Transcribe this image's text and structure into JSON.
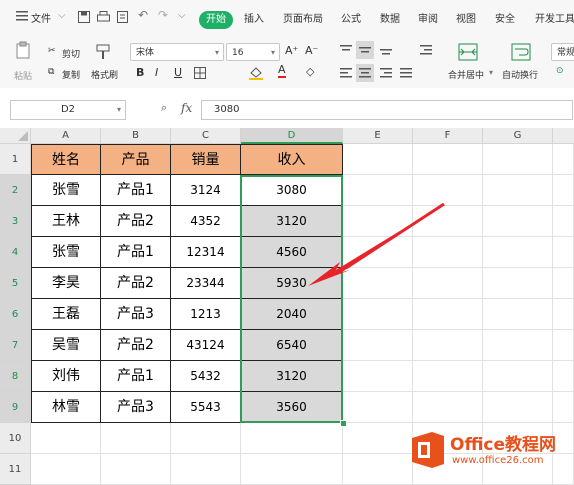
{
  "menubar": {
    "file": "文件",
    "tabs": [
      "开始",
      "插入",
      "页面布局",
      "公式",
      "数据",
      "审阅",
      "视图",
      "安全",
      "开发工具"
    ]
  },
  "ribbon": {
    "paste": "粘贴",
    "cut": "剪切",
    "copy": "复制",
    "format_painter": "格式刷",
    "font_name": "宋体",
    "font_size": "16",
    "bold": "B",
    "italic": "I",
    "underline": "U",
    "merge_center": "合并居中",
    "auto_wrap": "自动换行",
    "number_format": "常规"
  },
  "formula_bar": {
    "name_box": "D2",
    "fx": "fx",
    "value": "3080"
  },
  "sheet": {
    "columns": [
      "A",
      "B",
      "C",
      "D",
      "E",
      "F",
      "G"
    ],
    "rows": [
      "1",
      "2",
      "3",
      "4",
      "5",
      "6",
      "7",
      "8",
      "9",
      "10",
      "11"
    ],
    "headers": [
      "姓名",
      "产品",
      "销量",
      "收入"
    ],
    "data": [
      [
        "张雪",
        "产品1",
        "3124",
        "3080"
      ],
      [
        "王林",
        "产品2",
        "4352",
        "3120"
      ],
      [
        "张雪",
        "产品1",
        "12314",
        "4560"
      ],
      [
        "李昊",
        "产品2",
        "23344",
        "5930"
      ],
      [
        "王磊",
        "产品3",
        "1213",
        "2040"
      ],
      [
        "吴雪",
        "产品2",
        "43124",
        "6540"
      ],
      [
        "刘伟",
        "产品1",
        "5432",
        "3120"
      ],
      [
        "林雪",
        "产品3",
        "5543",
        "3560"
      ]
    ]
  },
  "watermark": {
    "brand": "Office教程网",
    "url": "www.office26.com"
  },
  "colors": {
    "active_tab": "#1eb067",
    "header_fill": "#f4b183",
    "selection": "#2f9d58",
    "arrow": "#e8242b",
    "logo": "#e8501c"
  }
}
